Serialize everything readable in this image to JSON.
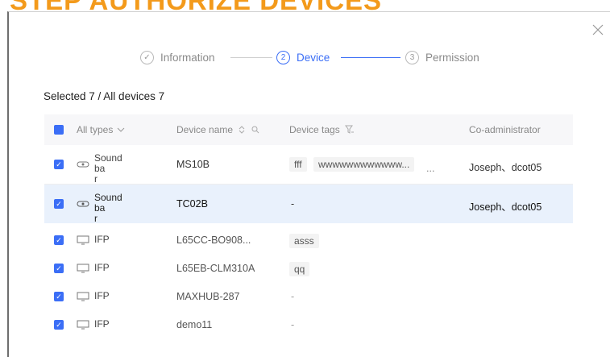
{
  "banner": {
    "title": "STEP AUTHORIZE DEVICES"
  },
  "steps": [
    {
      "index": "✓",
      "label": "Information"
    },
    {
      "index": "2",
      "label": "Device"
    },
    {
      "index": "3",
      "label": "Permission"
    }
  ],
  "summary": "Selected 7 / All devices 7",
  "table": {
    "headers": {
      "type": "All types",
      "name": "Device name",
      "tags": "Device tags",
      "coadmin": "Co-administrator"
    },
    "rows": [
      {
        "type_l1": "Sound ba",
        "type_l2": "r",
        "name": "MS10B",
        "tag1": "fff",
        "tag2": "wwwwwwwwwwww...",
        "more": "...",
        "coadmin": "Joseph、dcot05"
      },
      {
        "type_l1": "Sound ba",
        "type_l2": "r",
        "name": "TC02B",
        "dash": "-",
        "coadmin": "Joseph、dcot05"
      },
      {
        "type": "IFP",
        "name": "L65CC-BO908...",
        "tag1": "asss"
      },
      {
        "type": "IFP",
        "name": "L65EB-CLM310A",
        "tag1": "qq"
      },
      {
        "type": "IFP",
        "name": "MAXHUB-287",
        "dash": "-"
      },
      {
        "type": "IFP",
        "name": "demo11",
        "dash": "-"
      }
    ]
  },
  "colors": {
    "accent": "#3b6ef6",
    "highlight": "#e9f1fc",
    "banner": "#f39a1b"
  }
}
